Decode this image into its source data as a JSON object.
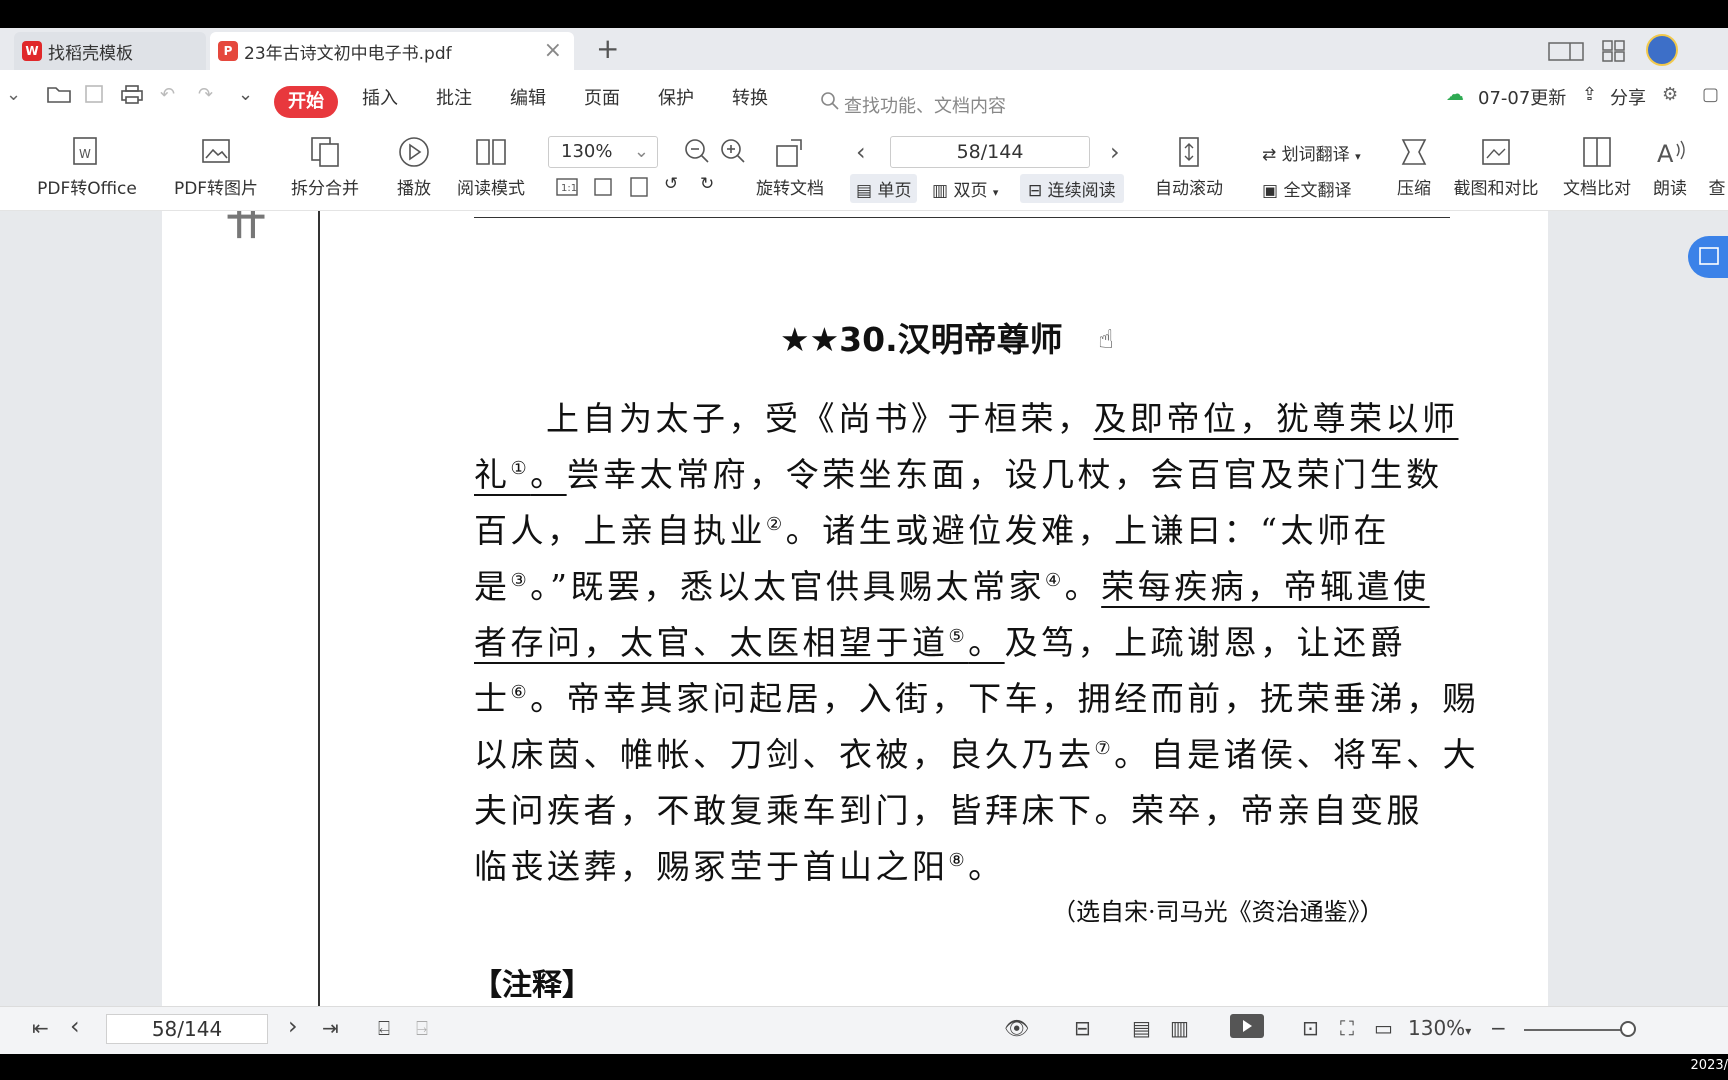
{
  "tabs": [
    {
      "label": "找稻壳模板",
      "active": false
    },
    {
      "label": "23年古诗文初中电子书.pdf",
      "active": true
    }
  ],
  "menu": {
    "items": [
      "开始",
      "插入",
      "批注",
      "编辑",
      "页面",
      "保护",
      "转换"
    ],
    "search_placeholder": "查找功能、文档内容",
    "update_label": "07-07更新",
    "share_label": "分享"
  },
  "toolbar": {
    "pdf_to_office": "PDF转Office",
    "pdf_to_image": "PDF转图片",
    "split_merge": "拆分合并",
    "play": "播放",
    "read_mode": "阅读模式",
    "zoom": "130%",
    "rotate": "旋转文档",
    "page_indicator": "58/144",
    "single_page": "单页",
    "double_page": "双页",
    "continuous": "连续阅读",
    "auto_scroll": "自动滚动",
    "word_translate": "划词翻译",
    "full_translate": "全文翻译",
    "compress": "压缩",
    "screenshot_compare": "截图和对比",
    "doc_compare": "文档比对",
    "read_aloud": "朗读",
    "find": "查"
  },
  "document": {
    "heading": "★★30.汉明帝尊师",
    "source": "（选自宋·司马光《资治通鉴》）",
    "notes_heading": "【注释】"
  },
  "statusbar": {
    "page_indicator": "58/144",
    "zoom": "130%",
    "clock": "2023/"
  },
  "colors": {
    "accent": "#e8383d",
    "side_button": "#3b82e8"
  }
}
